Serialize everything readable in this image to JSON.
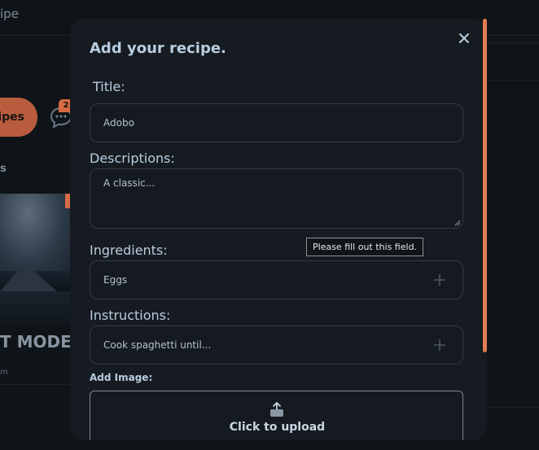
{
  "background": {
    "header_title": "ipe",
    "active_pill_label": "ipes",
    "chat_badge_count": "2",
    "section_heading": "s",
    "card_title": "T MODE",
    "card_meta": "m"
  },
  "modal": {
    "title": "Add your recipe.",
    "fields": {
      "title_label": "Title:",
      "title_value": "Adobo",
      "description_label": "Descriptions:",
      "description_value": "A classic...",
      "ingredients_label": "Ingredients:",
      "ingredients_value": "Eggs",
      "instructions_label": "Instructions:",
      "instructions_value": "Cook spaghetti until...",
      "image_label": "Add Image:",
      "upload_text": "Click to upload"
    }
  },
  "tooltip": "Please fill out this field.",
  "colors": {
    "accent": "#e07d55",
    "pill": "#b95c3e",
    "modal_bg": "#151b20",
    "page_bg": "#0f1418",
    "title_text": "#b9cde0"
  },
  "icons": [
    "close-icon",
    "plus-icon",
    "upload-icon",
    "chat-icon",
    "resize-handle-icon"
  ]
}
